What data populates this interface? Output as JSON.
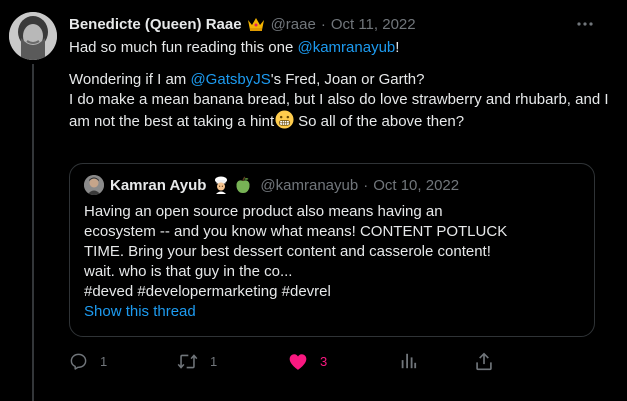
{
  "tweet": {
    "author_name": "Benedicte (Queen) Raae",
    "author_badge_icon": "crown-emoji",
    "handle": "@raae",
    "date": "Oct 11, 2022",
    "separator": "·",
    "body": {
      "line1_text": "Had so much fun reading this one ",
      "line1_mention": "@kamranayub",
      "line1_end": "!",
      "line2_mention": "@GatsbyJS",
      "line2_text": "'s Fred, Joan or Garth?",
      "line3_pre": "I do make a mean banana bread, but I also do love strawberry and rhubarb, and I am not the best at taking a hint",
      "line3_post": "So all of the above then?"
    }
  },
  "quote": {
    "author_name": "Kamran Ayub",
    "handle": "@kamranayub",
    "separator": "·",
    "date": "Oct 10, 2022",
    "text_line1": "Having an open source product also means having an",
    "text_line2": "ecosystem -- and you know what means! CONTENT POTLUCK",
    "text_line3": "TIME. Bring your best dessert content and casserole content!",
    "text_line4": "wait. who is that guy in the co...",
    "hashtags": "#deved #developermarketing #devrel",
    "show_thread": "Show this thread"
  },
  "actions": {
    "reply_count": "1",
    "retweet_count": "1",
    "like_count": "3",
    "views_count": "",
    "share_count": ""
  },
  "colors": {
    "background": "#000000",
    "text": "#e7e9ea",
    "muted": "#71767b",
    "link": "#1d9bf0",
    "like": "#f91880",
    "border": "#2f3336"
  }
}
